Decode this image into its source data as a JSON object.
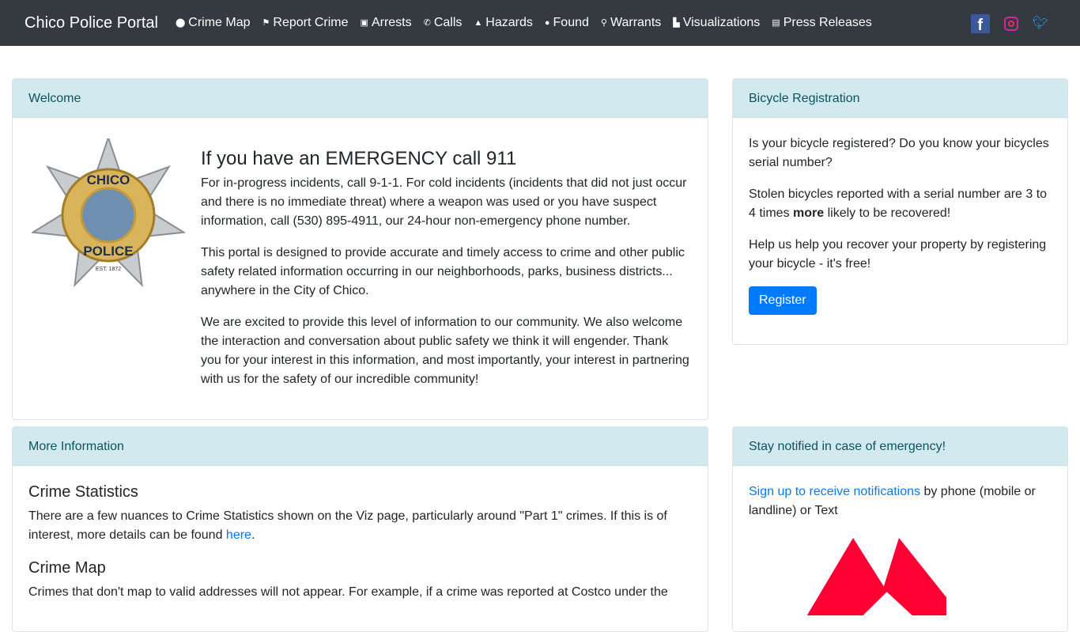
{
  "nav": {
    "brand": "Chico Police Portal",
    "items": [
      {
        "label": "Crime Map",
        "icon": "map-marker-icon",
        "glyph": "⬤"
      },
      {
        "label": "Report Crime",
        "icon": "flag-icon",
        "glyph": "⚑"
      },
      {
        "label": "Arrests",
        "icon": "id-card-icon",
        "glyph": "▣"
      },
      {
        "label": "Calls",
        "icon": "phone-icon",
        "glyph": "✆"
      },
      {
        "label": "Hazards",
        "icon": "warning-icon",
        "glyph": "▲"
      },
      {
        "label": "Found",
        "icon": "compass-icon",
        "glyph": "●"
      },
      {
        "label": "Warrants",
        "icon": "search-icon",
        "glyph": "⚲"
      },
      {
        "label": "Visualizations",
        "icon": "chart-icon",
        "glyph": "▙"
      },
      {
        "label": "Press Releases",
        "icon": "newspaper-icon",
        "glyph": "▤"
      }
    ],
    "social": {
      "facebook": "f"
    }
  },
  "welcome": {
    "header": "Welcome",
    "badge": "CHICO POLICE EST. 1872",
    "title": "If you have an EMERGENCY call 911",
    "p1": "For in-progress incidents, call 9-1-1. For cold incidents (incidents that did not just occur and there is no immediate threat) where a weapon was used or you have suspect information, call (530) 895-4911, our 24-hour non-emergency phone number.",
    "p2": "This portal is designed to provide accurate and timely access to crime and other public safety related information occurring in our neighborhoods, parks, business districts... anywhere in the City of Chico.",
    "p3": "We are excited to provide this level of information to our community. We also welcome the interaction and conversation about public safety we think it will engender. Thank you for your interest in this information, and most importantly, your interest in partnering with us for the safety of our incredible community!"
  },
  "bike": {
    "header": "Bicycle Registration",
    "p1": "Is your bicycle registered? Do you know your bicycles serial number?",
    "p2a": "Stolen bicycles reported with a serial number are 3 to 4 times ",
    "p2b": "more",
    "p2c": " likely to be recovered!",
    "p3": "Help us help you recover your property by registering your bicycle - it's free!",
    "button": "Register"
  },
  "more": {
    "header": "More Information",
    "h1": "Crime Statistics",
    "p1a": "There are a few nuances to Crime Statistics shown on the Viz page, particularly around \"Part 1\" crimes. If this is of interest, more details can be found ",
    "p1link": "here",
    "p1b": ".",
    "h2": "Crime Map",
    "p2": "Crimes that don't map to valid addresses will not appear. For example, if a crime was reported at Costco under the"
  },
  "notify": {
    "header": "Stay notified in case of emergency!",
    "link": "Sign up to receive notifications",
    "text": " by phone (mobile or landline) or Text",
    "logo_color": "#ff0033"
  }
}
